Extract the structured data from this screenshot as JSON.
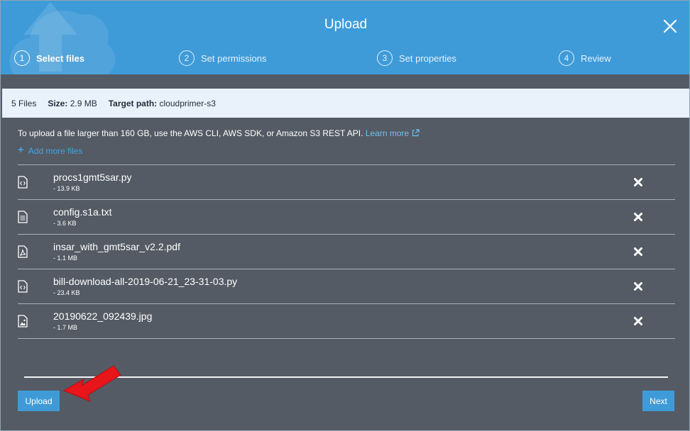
{
  "header": {
    "title": "Upload",
    "steps": [
      {
        "number": "1",
        "label": "Select files",
        "active": true
      },
      {
        "number": "2",
        "label": "Set permissions",
        "active": false
      },
      {
        "number": "3",
        "label": "Set properties",
        "active": false
      },
      {
        "number": "4",
        "label": "Review",
        "active": false
      }
    ]
  },
  "summary": {
    "file_count": "5 Files",
    "size_label": "Size:",
    "size_value": "2.9 MB",
    "target_label": "Target path:",
    "target_value": "cloudprimer-s3"
  },
  "info": {
    "message": "To upload a file larger than 160 GB, use the AWS CLI, AWS SDK, or Amazon S3 REST API.",
    "learn_more": "Learn more",
    "add_more_files": "Add more files"
  },
  "files": [
    {
      "name": "procs1gmt5sar.py",
      "size": "- 13.9 KB",
      "icon": "code-file-icon"
    },
    {
      "name": "config.s1a.txt",
      "size": "- 3.6 KB",
      "icon": "text-file-icon"
    },
    {
      "name": "insar_with_gmt5sar_v2.2.pdf",
      "size": "- 1.1 MB",
      "icon": "pdf-file-icon"
    },
    {
      "name": "bill-download-all-2019-06-21_23-31-03.py",
      "size": "- 23.4 KB",
      "icon": "code-file-icon"
    },
    {
      "name": "20190622_092439.jpg",
      "size": "- 1.7 MB",
      "icon": "image-file-icon"
    }
  ],
  "footer": {
    "upload_label": "Upload",
    "next_label": "Next"
  },
  "colors": {
    "header": "#3f9bd8",
    "body": "#545b64",
    "summary_bg": "#e9f2fa",
    "link": "#6ec1f0",
    "button": "#3f9bd8",
    "annotation_arrow": "#e8151b"
  }
}
